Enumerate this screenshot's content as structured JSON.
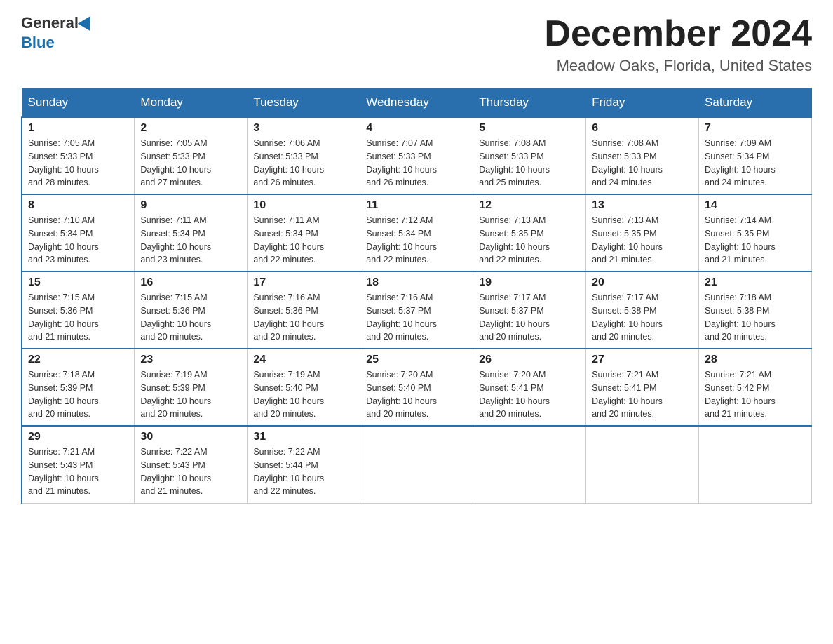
{
  "header": {
    "logo_general": "General",
    "logo_blue": "Blue",
    "month_title": "December 2024",
    "location": "Meadow Oaks, Florida, United States"
  },
  "days_of_week": [
    "Sunday",
    "Monday",
    "Tuesday",
    "Wednesday",
    "Thursday",
    "Friday",
    "Saturday"
  ],
  "weeks": [
    [
      {
        "day": "1",
        "sunrise": "7:05 AM",
        "sunset": "5:33 PM",
        "daylight": "10 hours and 28 minutes."
      },
      {
        "day": "2",
        "sunrise": "7:05 AM",
        "sunset": "5:33 PM",
        "daylight": "10 hours and 27 minutes."
      },
      {
        "day": "3",
        "sunrise": "7:06 AM",
        "sunset": "5:33 PM",
        "daylight": "10 hours and 26 minutes."
      },
      {
        "day": "4",
        "sunrise": "7:07 AM",
        "sunset": "5:33 PM",
        "daylight": "10 hours and 26 minutes."
      },
      {
        "day": "5",
        "sunrise": "7:08 AM",
        "sunset": "5:33 PM",
        "daylight": "10 hours and 25 minutes."
      },
      {
        "day": "6",
        "sunrise": "7:08 AM",
        "sunset": "5:33 PM",
        "daylight": "10 hours and 24 minutes."
      },
      {
        "day": "7",
        "sunrise": "7:09 AM",
        "sunset": "5:34 PM",
        "daylight": "10 hours and 24 minutes."
      }
    ],
    [
      {
        "day": "8",
        "sunrise": "7:10 AM",
        "sunset": "5:34 PM",
        "daylight": "10 hours and 23 minutes."
      },
      {
        "day": "9",
        "sunrise": "7:11 AM",
        "sunset": "5:34 PM",
        "daylight": "10 hours and 23 minutes."
      },
      {
        "day": "10",
        "sunrise": "7:11 AM",
        "sunset": "5:34 PM",
        "daylight": "10 hours and 22 minutes."
      },
      {
        "day": "11",
        "sunrise": "7:12 AM",
        "sunset": "5:34 PM",
        "daylight": "10 hours and 22 minutes."
      },
      {
        "day": "12",
        "sunrise": "7:13 AM",
        "sunset": "5:35 PM",
        "daylight": "10 hours and 22 minutes."
      },
      {
        "day": "13",
        "sunrise": "7:13 AM",
        "sunset": "5:35 PM",
        "daylight": "10 hours and 21 minutes."
      },
      {
        "day": "14",
        "sunrise": "7:14 AM",
        "sunset": "5:35 PM",
        "daylight": "10 hours and 21 minutes."
      }
    ],
    [
      {
        "day": "15",
        "sunrise": "7:15 AM",
        "sunset": "5:36 PM",
        "daylight": "10 hours and 21 minutes."
      },
      {
        "day": "16",
        "sunrise": "7:15 AM",
        "sunset": "5:36 PM",
        "daylight": "10 hours and 20 minutes."
      },
      {
        "day": "17",
        "sunrise": "7:16 AM",
        "sunset": "5:36 PM",
        "daylight": "10 hours and 20 minutes."
      },
      {
        "day": "18",
        "sunrise": "7:16 AM",
        "sunset": "5:37 PM",
        "daylight": "10 hours and 20 minutes."
      },
      {
        "day": "19",
        "sunrise": "7:17 AM",
        "sunset": "5:37 PM",
        "daylight": "10 hours and 20 minutes."
      },
      {
        "day": "20",
        "sunrise": "7:17 AM",
        "sunset": "5:38 PM",
        "daylight": "10 hours and 20 minutes."
      },
      {
        "day": "21",
        "sunrise": "7:18 AM",
        "sunset": "5:38 PM",
        "daylight": "10 hours and 20 minutes."
      }
    ],
    [
      {
        "day": "22",
        "sunrise": "7:18 AM",
        "sunset": "5:39 PM",
        "daylight": "10 hours and 20 minutes."
      },
      {
        "day": "23",
        "sunrise": "7:19 AM",
        "sunset": "5:39 PM",
        "daylight": "10 hours and 20 minutes."
      },
      {
        "day": "24",
        "sunrise": "7:19 AM",
        "sunset": "5:40 PM",
        "daylight": "10 hours and 20 minutes."
      },
      {
        "day": "25",
        "sunrise": "7:20 AM",
        "sunset": "5:40 PM",
        "daylight": "10 hours and 20 minutes."
      },
      {
        "day": "26",
        "sunrise": "7:20 AM",
        "sunset": "5:41 PM",
        "daylight": "10 hours and 20 minutes."
      },
      {
        "day": "27",
        "sunrise": "7:21 AM",
        "sunset": "5:41 PM",
        "daylight": "10 hours and 20 minutes."
      },
      {
        "day": "28",
        "sunrise": "7:21 AM",
        "sunset": "5:42 PM",
        "daylight": "10 hours and 21 minutes."
      }
    ],
    [
      {
        "day": "29",
        "sunrise": "7:21 AM",
        "sunset": "5:43 PM",
        "daylight": "10 hours and 21 minutes."
      },
      {
        "day": "30",
        "sunrise": "7:22 AM",
        "sunset": "5:43 PM",
        "daylight": "10 hours and 21 minutes."
      },
      {
        "day": "31",
        "sunrise": "7:22 AM",
        "sunset": "5:44 PM",
        "daylight": "10 hours and 22 minutes."
      },
      null,
      null,
      null,
      null
    ]
  ],
  "labels": {
    "sunrise": "Sunrise:",
    "sunset": "Sunset:",
    "daylight": "Daylight:"
  }
}
